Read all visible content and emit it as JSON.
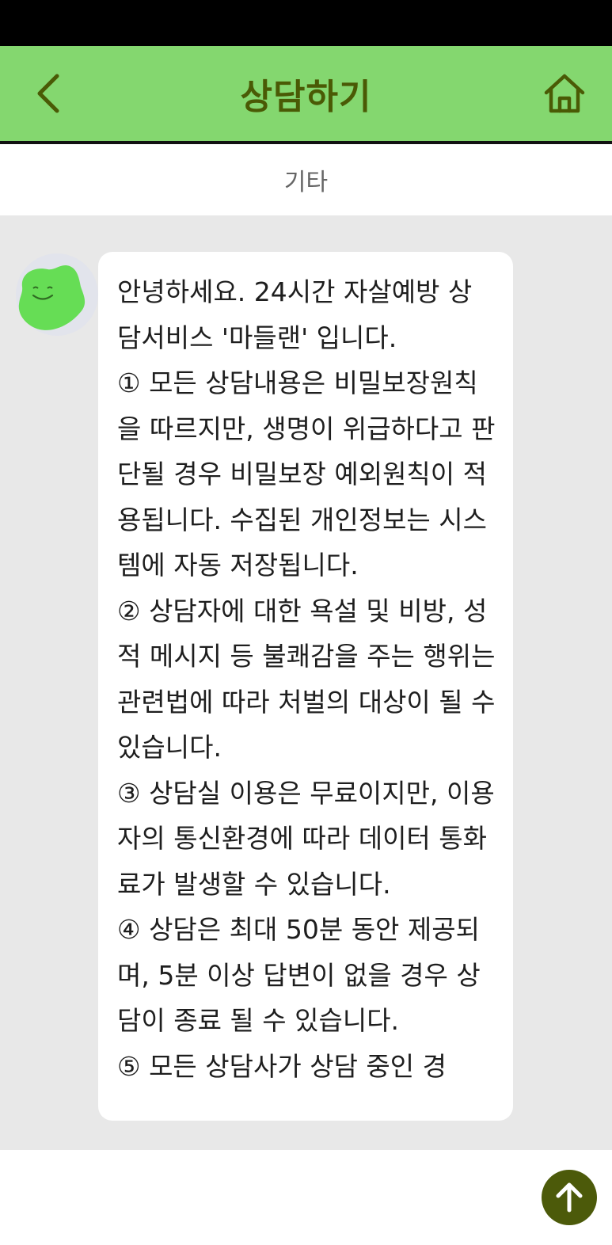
{
  "header": {
    "title": "상담하기",
    "back_icon": "chevron-left-icon",
    "home_icon": "home-icon"
  },
  "category": {
    "label": "기타"
  },
  "message": {
    "lines": [
      "안녕하세요. 24시간 자살예방 상담서비스 '마들랜' 입니다.",
      "① 모든 상담내용은 비밀보장원칙을 따르지만, 생명이 위급하다고 판단될 경우 비밀보장 예외원칙이 적용됩니다. 수집된 개인정보는 시스템에 자동 저장됩니다.",
      "② 상담자에 대한 욕설 및 비방, 성적 메시지 등 불쾌감을 주는 행위는 관련법에 따라 처벌의 대상이 될 수 있습니다.",
      "③ 상담실 이용은 무료이지만, 이용자의 통신환경에 따라 데이터 통화료가 발생할 수 있습니다.",
      "④ 상담은 최대 50분 동안 제공되며, 5분 이상 답변이 없을 경우 상담이 종료 될 수 있습니다.",
      "⑤ 모든 상담사가 상담 중인 경"
    ]
  },
  "input": {
    "send_icon": "arrow-up-icon"
  },
  "colors": {
    "header_bg": "#84d76f",
    "title_text": "#4a5a05",
    "chat_bg": "#e8e8e8",
    "send_button": "#4c5a0a",
    "avatar_blob": "#66dd55"
  }
}
